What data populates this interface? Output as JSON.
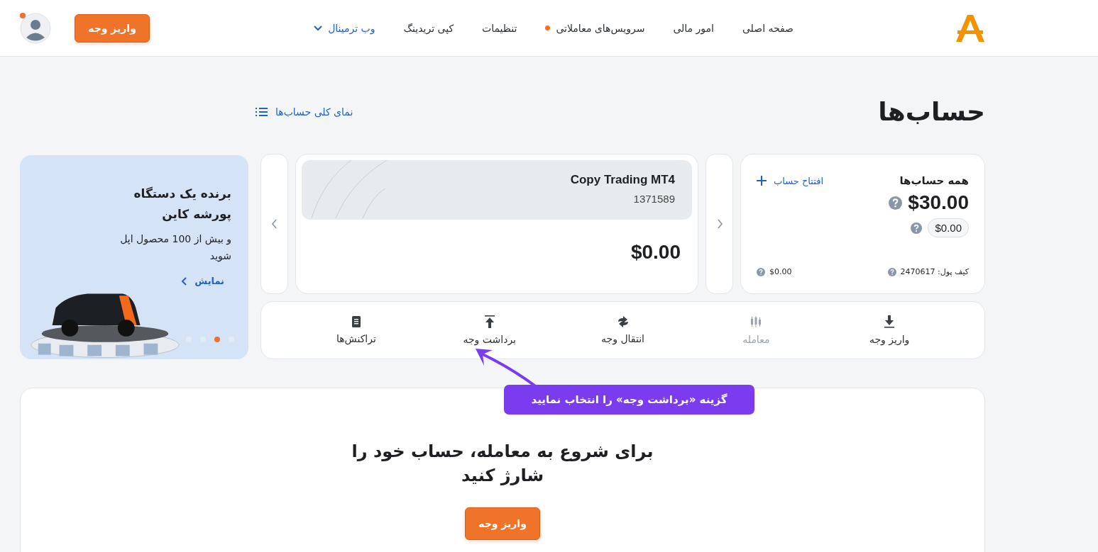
{
  "header": {
    "nav": [
      {
        "label": "صفحه اصلی",
        "dot": false,
        "dropdown": false
      },
      {
        "label": "امور مالی",
        "dot": false,
        "dropdown": false
      },
      {
        "label": "سرویس‌های معاملاتی",
        "dot": true,
        "dropdown": false
      },
      {
        "label": "تنظیمات",
        "dot": false,
        "dropdown": false
      },
      {
        "label": "کپی تریدینگ",
        "dot": false,
        "dropdown": false
      },
      {
        "label": "وب ترمینال",
        "dot": false,
        "dropdown": true
      }
    ],
    "deposit_button": "واریز وجه",
    "avatar_badge": true
  },
  "page": {
    "title": "حساب‌ها",
    "overview_link": "نمای کلی حساب‌ها"
  },
  "summary": {
    "title": "همه حساب‌ها",
    "open_account": "افتتاح حساب",
    "total": "$30.00",
    "secondary": "$0.00",
    "wallet": "کیف پول: 2470617",
    "wallet_balance": "$0.00"
  },
  "account": {
    "name": "Copy Trading MT4",
    "number": "1371589",
    "balance": "$0.00"
  },
  "actions": [
    {
      "label": "واریز وجه",
      "disabled": false
    },
    {
      "label": "معامله",
      "disabled": true
    },
    {
      "label": "انتقال وجه",
      "disabled": false
    },
    {
      "label": "برداشت وجه",
      "disabled": false
    },
    {
      "label": "تراکنش‌ها",
      "disabled": false
    }
  ],
  "promo": {
    "title": "برنده یک دستگاه پورشه کاین",
    "text": "و بیش از 100 محصول اپل شوید",
    "link": "نمایش",
    "dots": [
      {
        "selected": false
      },
      {
        "selected": true
      },
      {
        "selected": false
      },
      {
        "selected": false
      }
    ]
  },
  "empty_state": {
    "heading": "برای شروع به معامله، حساب خود را شارژ کنید",
    "button": "واریز وجه"
  },
  "callout": "گزینه «برداشت وجه» را انتخاب نمایید"
}
